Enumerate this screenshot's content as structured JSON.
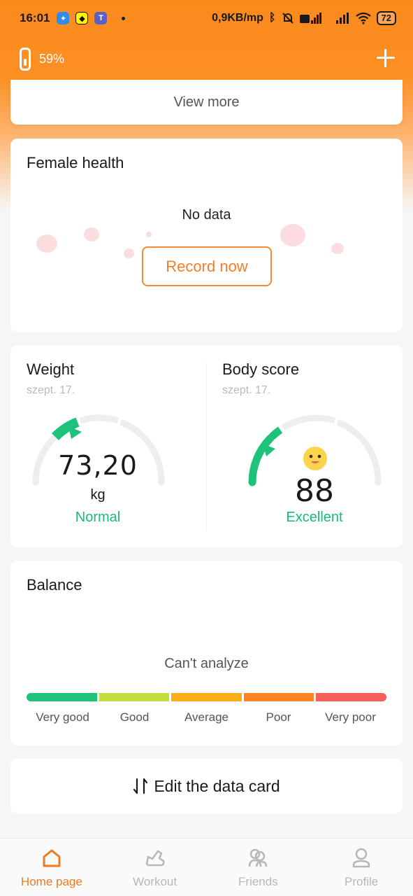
{
  "status_bar": {
    "time": "16:01",
    "network_speed": "0,9KB/mp",
    "battery": "72"
  },
  "device": {
    "battery_percent": "59%"
  },
  "view_more": {
    "label": "View more"
  },
  "female_health": {
    "title": "Female health",
    "no_data": "No data",
    "record_label": "Record now"
  },
  "weight": {
    "title": "Weight",
    "date": "szept. 17.",
    "value": "73,20",
    "unit": "kg",
    "status": "Normal"
  },
  "body_score": {
    "title": "Body score",
    "date": "szept. 17.",
    "value": "88",
    "status": "Excellent"
  },
  "balance": {
    "title": "Balance",
    "message": "Can't analyze",
    "scale": [
      {
        "label": "Very good",
        "color": "#1ec27a"
      },
      {
        "label": "Good",
        "color": "#c5dc40"
      },
      {
        "label": "Average",
        "color": "#fbac1a"
      },
      {
        "label": "Poor",
        "color": "#fc8424"
      },
      {
        "label": "Very poor",
        "color": "#f7605a"
      }
    ]
  },
  "edit_card": {
    "label": "Edit the data card"
  },
  "tabs": [
    {
      "label": "Home page",
      "icon": "home-icon",
      "active": true
    },
    {
      "label": "Workout",
      "icon": "shoe-icon",
      "active": false
    },
    {
      "label": "Friends",
      "icon": "friends-icon",
      "active": false
    },
    {
      "label": "Profile",
      "icon": "profile-icon",
      "active": false
    }
  ],
  "colors": {
    "accent": "#f07a1f",
    "good": "#1ab87a"
  }
}
